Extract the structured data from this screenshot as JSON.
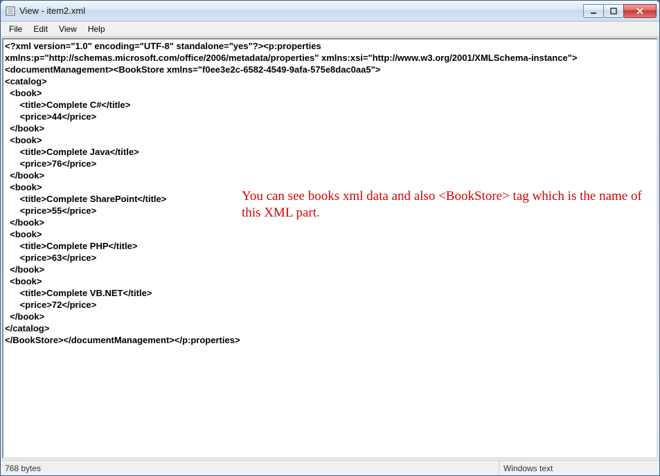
{
  "window": {
    "title": "View - item2.xml"
  },
  "menu": {
    "file": "File",
    "edit": "Edit",
    "view": "View",
    "help": "Help"
  },
  "xml": {
    "line1": "<?xml version=\"1.0\" encoding=\"UTF-8\" standalone=\"yes\"?><p:properties",
    "line2": "xmlns:p=\"http://schemas.microsoft.com/office/2006/metadata/properties\" xmlns:xsi=\"http://www.w3.org/2001/XMLSchema-instance\">",
    "line3": "<documentManagement><BookStore xmlns=\"f0ee3e2c-6582-4549-9afa-575e8dac0aa5\">",
    "catalog_open": "<catalog>",
    "book_open": "  <book>",
    "book_close": "  </book>",
    "catalog_close": "</catalog>",
    "closing": "</BookStore></documentManagement></p:properties>",
    "books": [
      {
        "title": "      <title>Complete C#</title>",
        "price": "      <price>44</price>"
      },
      {
        "title": "      <title>Complete Java</title>",
        "price": "      <price>76</price>"
      },
      {
        "title": "      <title>Complete SharePoint</title>",
        "price": "      <price>55</price>"
      },
      {
        "title": "      <title>Complete PHP</title>",
        "price": "      <price>63</price>"
      },
      {
        "title": "      <title>Complete VB.NET</title>",
        "price": "      <price>72</price>"
      }
    ]
  },
  "annotation": {
    "text": "You can see books xml data and also <BookStore> tag which is the name of this XML part."
  },
  "status": {
    "size": "768 bytes",
    "encoding": "Windows text"
  }
}
